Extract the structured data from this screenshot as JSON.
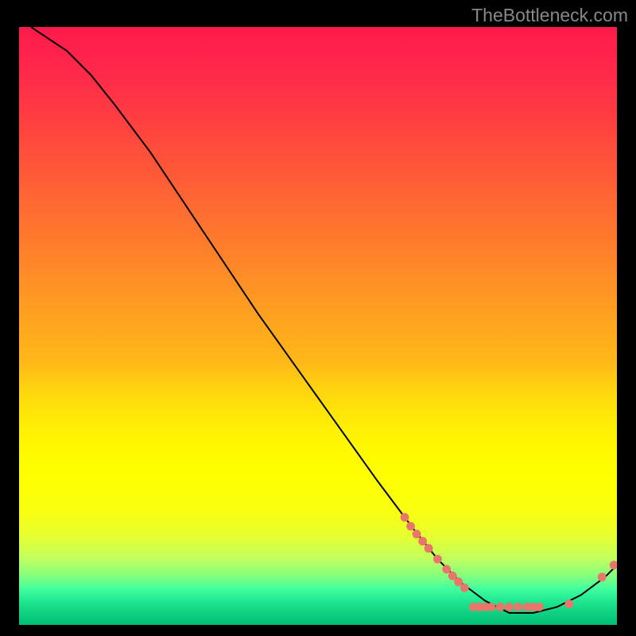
{
  "watermark": "TheBottleneck.com",
  "chart_data": {
    "type": "line",
    "title": "",
    "xlabel": "",
    "ylabel": "",
    "xlim": [
      0,
      100
    ],
    "ylim": [
      0,
      100
    ],
    "curve": [
      {
        "x": 2,
        "y": 100
      },
      {
        "x": 8,
        "y": 96
      },
      {
        "x": 12,
        "y": 92
      },
      {
        "x": 16,
        "y": 87
      },
      {
        "x": 22,
        "y": 79
      },
      {
        "x": 30,
        "y": 67
      },
      {
        "x": 40,
        "y": 52
      },
      {
        "x": 50,
        "y": 38
      },
      {
        "x": 60,
        "y": 24
      },
      {
        "x": 66,
        "y": 16
      },
      {
        "x": 70,
        "y": 11
      },
      {
        "x": 74,
        "y": 7
      },
      {
        "x": 78,
        "y": 4
      },
      {
        "x": 82,
        "y": 2
      },
      {
        "x": 86,
        "y": 2
      },
      {
        "x": 90,
        "y": 3
      },
      {
        "x": 94,
        "y": 5
      },
      {
        "x": 98,
        "y": 8
      },
      {
        "x": 100,
        "y": 10
      }
    ],
    "scatter_points": [
      {
        "x": 64.5,
        "y": 18
      },
      {
        "x": 65.5,
        "y": 16.5
      },
      {
        "x": 66.5,
        "y": 15.2
      },
      {
        "x": 67.5,
        "y": 14
      },
      {
        "x": 68.5,
        "y": 12.8
      },
      {
        "x": 70,
        "y": 11
      },
      {
        "x": 71.5,
        "y": 9.3
      },
      {
        "x": 72.5,
        "y": 8.2
      },
      {
        "x": 73.5,
        "y": 7.2
      },
      {
        "x": 74.5,
        "y": 6.2
      },
      {
        "x": 76,
        "y": 3
      },
      {
        "x": 77,
        "y": 3
      },
      {
        "x": 78,
        "y": 3
      },
      {
        "x": 79,
        "y": 3
      },
      {
        "x": 80.5,
        "y": 3
      },
      {
        "x": 82,
        "y": 3
      },
      {
        "x": 83.5,
        "y": 3
      },
      {
        "x": 85,
        "y": 3
      },
      {
        "x": 86,
        "y": 3
      },
      {
        "x": 87,
        "y": 3
      },
      {
        "x": 92,
        "y": 3.5
      },
      {
        "x": 97.5,
        "y": 8
      },
      {
        "x": 99.5,
        "y": 10
      }
    ],
    "gradient": {
      "top": "#ff1a4d",
      "mid_upper": "#ff8828",
      "mid_lower": "#fff800",
      "bottom": "#00c078"
    }
  }
}
